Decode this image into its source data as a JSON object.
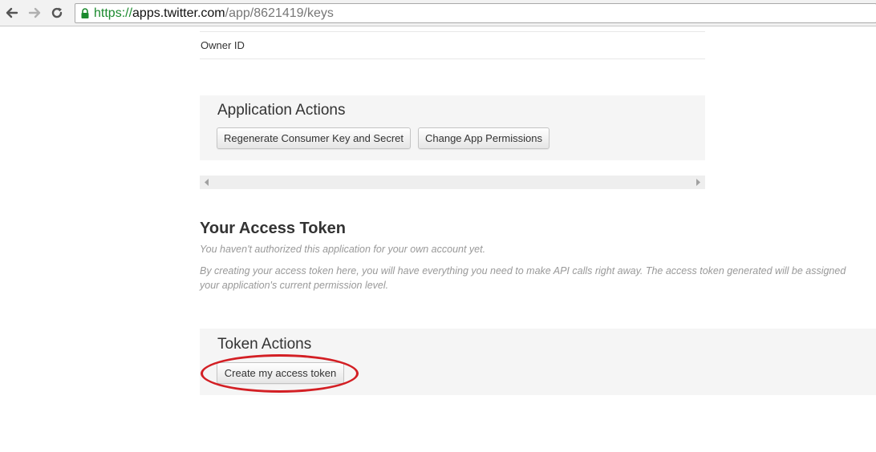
{
  "browser": {
    "url_scheme": "https://",
    "url_host": "apps.twitter.com",
    "url_path": "/app/8621419/keys"
  },
  "owner": {
    "label": "Owner ID"
  },
  "application_actions": {
    "title": "Application Actions",
    "regenerate_label": "Regenerate Consumer Key and Secret",
    "permissions_label": "Change App Permissions"
  },
  "access_token": {
    "title": "Your Access Token",
    "not_authorized": "You haven't authorized this application for your own account yet.",
    "description_line1": "By creating your access token here, you will have everything you need to make API calls right away. The access token generated will be assigned",
    "description_line2": "your application's current permission level."
  },
  "token_actions": {
    "title": "Token Actions",
    "create_label": "Create my access token"
  },
  "colors": {
    "highlight": "#d31f24",
    "secure_green": "#1b8a2e"
  }
}
